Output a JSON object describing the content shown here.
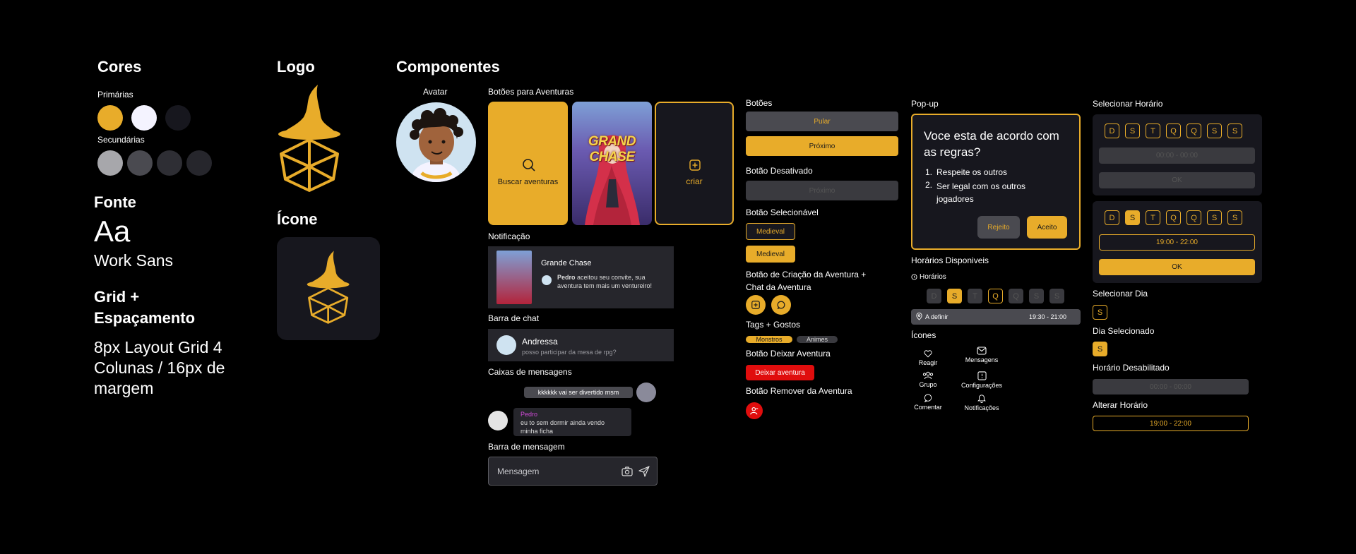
{
  "colors": {
    "primary": "#e8ac2a",
    "white": "#f4f3ff",
    "dark": "#17171e",
    "gray1": "#a7a7ab",
    "gray2": "#4a4a50",
    "gray3": "#2e2e34",
    "gray4": "#26262c",
    "red": "#e00d0d"
  },
  "sections": {
    "cores": "Cores",
    "logo": "Logo",
    "icone": "Ícone",
    "componentes": "Componentes"
  },
  "cores": {
    "primarias": "Primárias",
    "secundarias": "Secundárias"
  },
  "fonte": {
    "title": "Fonte",
    "sample": "Aa",
    "name": "Work Sans"
  },
  "grid": {
    "title": "Grid + Espaçamento",
    "text": "8px Layout Grid 4 Colunas / 16px de margem"
  },
  "avatar": {
    "label": "Avatar"
  },
  "adventure": {
    "label": "Botões para Aventuras",
    "search": "Buscar aventuras",
    "game": "GRAND CHASE",
    "create": "criar"
  },
  "notif": {
    "label": "Notificação",
    "title": "Grande Chase",
    "sender": "Pedro",
    "message": " aceitou seu convite, sua aventura tem mais um ventureiro!"
  },
  "chatbar": {
    "label": "Barra de chat",
    "name": "Andressa",
    "preview": "posso participar da mesa de rpg?"
  },
  "messages": {
    "label": "Caixas de mensagens",
    "sent": "kkkkkk vai ser divertido msm",
    "sender": "Pedro",
    "received": "eu to sem dormir ainda vendo minha ficha"
  },
  "msgbar": {
    "label": "Barra de mensagem",
    "placeholder": "Mensagem"
  },
  "botoes": {
    "label": "Botões",
    "skip": "Pular",
    "next": "Próximo",
    "disabled_label": "Botão Desativado",
    "disabled": "Próximo",
    "selectable_label": "Botão Selecionável",
    "sel1": "Medieval",
    "sel2": "Medieval",
    "create_label": "Botão de Criação da Aventura + Chat da Aventura",
    "tags_label": "Tags + Gostos",
    "tag1": "Monstros",
    "tag2": "Animes",
    "leave_label": "Botão Deixar Aventura",
    "leave": "Deixar aventura",
    "remove_label": "Botão Remover da Aventura"
  },
  "popup": {
    "label": "Pop-up",
    "title": "Voce esta de acordo com as regras?",
    "rule1": "Respeite os outros",
    "rule2": "Ser legal com os outros jogadores",
    "reject": "Rejeito",
    "accept": "Aceito"
  },
  "horarios": {
    "label": "Horários Disponiveis",
    "sub": "Horários",
    "days": [
      "D",
      "S",
      "T",
      "Q",
      "Q",
      "S",
      "S"
    ],
    "place": "A definir",
    "time": "19:30 - 21:00"
  },
  "icones": {
    "label": "Ícones",
    "react": "Reagir",
    "messages": "Mensagens",
    "group": "Grupo",
    "settings": "Configurações",
    "comment": "Comentar",
    "notifications": "Notificações"
  },
  "selhorario": {
    "label": "Selecionar Horário",
    "days": [
      "D",
      "S",
      "T",
      "Q",
      "Q",
      "S",
      "S"
    ],
    "range_empty": "00:00 - 00:00",
    "ok_disabled": "OK",
    "range": "19:00 - 22:00",
    "ok": "OK"
  },
  "seldia": {
    "label": "Selecionar Dia",
    "day": "S",
    "selected_label": "Dia Selecionado",
    "selected": "S"
  },
  "hordes": {
    "label": "Horário Desabilitado",
    "value": "00:00 - 00:00"
  },
  "alterar": {
    "label": "Alterar Horário",
    "value": "19:00 - 22:00"
  }
}
